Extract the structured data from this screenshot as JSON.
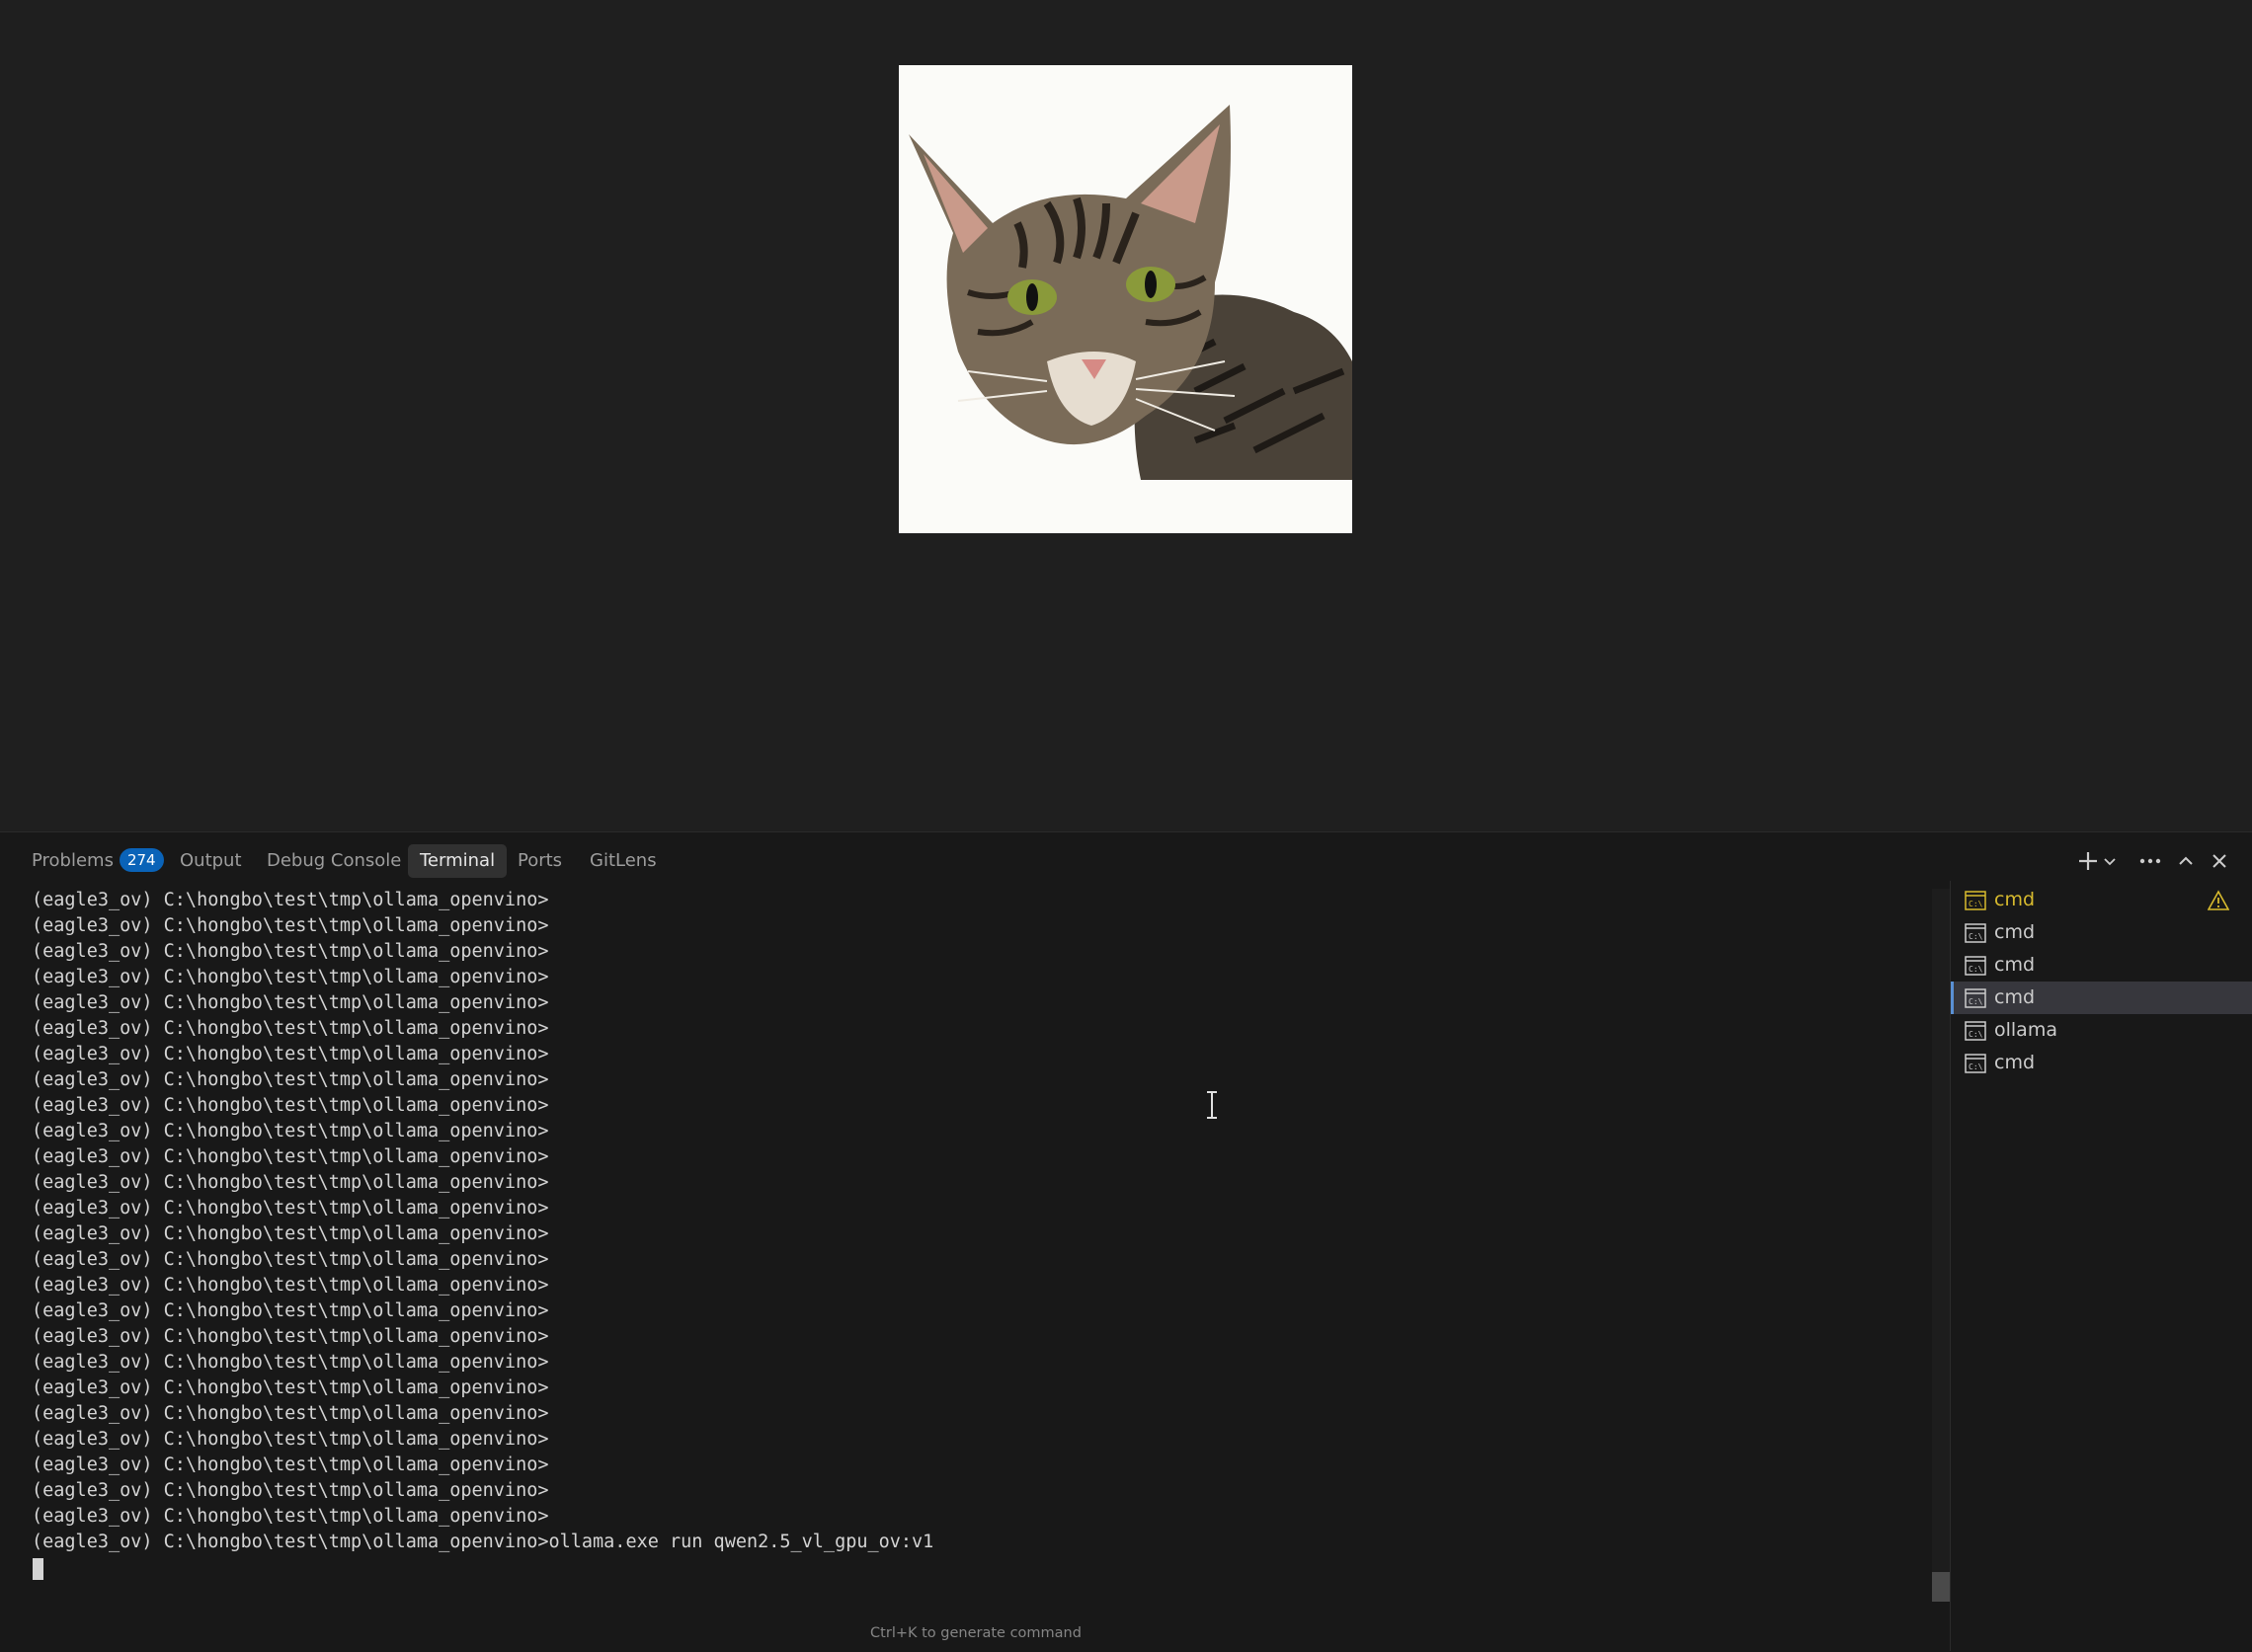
{
  "editor": {
    "image_alt": "tabby cat photo"
  },
  "panel": {
    "tabs": [
      {
        "label": "Problems",
        "badge": "274"
      },
      {
        "label": "Output"
      },
      {
        "label": "Debug Console"
      },
      {
        "label": "Terminal",
        "active": true
      },
      {
        "label": "Ports"
      },
      {
        "label": "GitLens"
      }
    ],
    "actions": [
      "new-terminal",
      "launch-profile-dropdown",
      "more-actions",
      "maximize-panel",
      "close-panel"
    ]
  },
  "terminal": {
    "lines": [
      "(eagle3_ov) C:\\hongbo\\test\\tmp\\ollama_openvino>",
      "(eagle3_ov) C:\\hongbo\\test\\tmp\\ollama_openvino>",
      "(eagle3_ov) C:\\hongbo\\test\\tmp\\ollama_openvino>",
      "(eagle3_ov) C:\\hongbo\\test\\tmp\\ollama_openvino>",
      "(eagle3_ov) C:\\hongbo\\test\\tmp\\ollama_openvino>",
      "(eagle3_ov) C:\\hongbo\\test\\tmp\\ollama_openvino>",
      "(eagle3_ov) C:\\hongbo\\test\\tmp\\ollama_openvino>",
      "(eagle3_ov) C:\\hongbo\\test\\tmp\\ollama_openvino>",
      "(eagle3_ov) C:\\hongbo\\test\\tmp\\ollama_openvino>",
      "(eagle3_ov) C:\\hongbo\\test\\tmp\\ollama_openvino>",
      "(eagle3_ov) C:\\hongbo\\test\\tmp\\ollama_openvino>",
      "(eagle3_ov) C:\\hongbo\\test\\tmp\\ollama_openvino>",
      "(eagle3_ov) C:\\hongbo\\test\\tmp\\ollama_openvino>",
      "(eagle3_ov) C:\\hongbo\\test\\tmp\\ollama_openvino>",
      "(eagle3_ov) C:\\hongbo\\test\\tmp\\ollama_openvino>",
      "(eagle3_ov) C:\\hongbo\\test\\tmp\\ollama_openvino>",
      "(eagle3_ov) C:\\hongbo\\test\\tmp\\ollama_openvino>",
      "(eagle3_ov) C:\\hongbo\\test\\tmp\\ollama_openvino>",
      "(eagle3_ov) C:\\hongbo\\test\\tmp\\ollama_openvino>",
      "(eagle3_ov) C:\\hongbo\\test\\tmp\\ollama_openvino>",
      "(eagle3_ov) C:\\hongbo\\test\\tmp\\ollama_openvino>",
      "(eagle3_ov) C:\\hongbo\\test\\tmp\\ollama_openvino>",
      "(eagle3_ov) C:\\hongbo\\test\\tmp\\ollama_openvino>",
      "(eagle3_ov) C:\\hongbo\\test\\tmp\\ollama_openvino>",
      "(eagle3_ov) C:\\hongbo\\test\\tmp\\ollama_openvino>",
      "(eagle3_ov) C:\\hongbo\\test\\tmp\\ollama_openvino>ollama.exe run qwen2.5_vl_gpu_ov:v1"
    ],
    "hint": "Ctrl+K to generate command"
  },
  "terminal_list": {
    "items": [
      {
        "label": "cmd",
        "warning": true
      },
      {
        "label": "cmd"
      },
      {
        "label": "cmd"
      },
      {
        "label": "cmd",
        "selected": true
      },
      {
        "label": "ollama"
      },
      {
        "label": "cmd"
      }
    ]
  },
  "colors": {
    "badge": "#0a63b8",
    "warning": "#d7ba2e",
    "selected_border": "#5a90d4",
    "background": "#181818"
  }
}
